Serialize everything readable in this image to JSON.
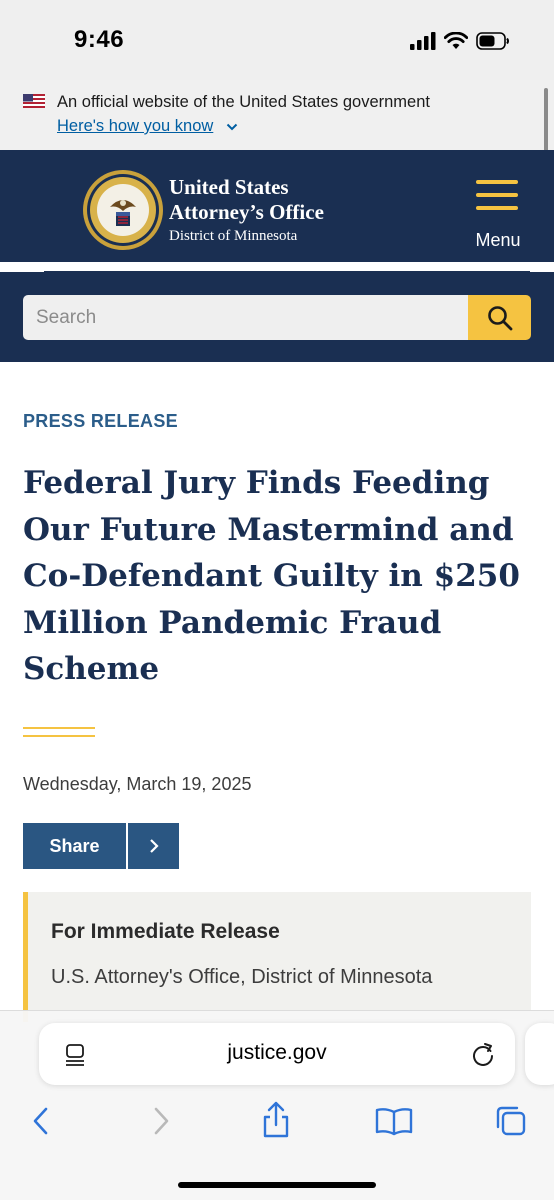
{
  "status_bar": {
    "time": "9:46",
    "icons": [
      "signal-icon",
      "wifi-icon",
      "battery-icon"
    ]
  },
  "gov_banner": {
    "text": "An official website of the United States government",
    "link": "Here's how you know"
  },
  "header": {
    "title_line1": "United States",
    "title_line2": "Attorney’s Office",
    "subtitle": "District of Minnesota",
    "menu_label": "Menu"
  },
  "search": {
    "placeholder": "Search"
  },
  "article": {
    "kicker": "PRESS RELEASE",
    "headline": "Federal Jury Finds Feeding Our Future Mastermind and Co-Defendant Guilty in $250 Million Pandemic Fraud Scheme",
    "date": "Wednesday, March 19, 2025",
    "share_label": "Share",
    "release_title": "For Immediate Release",
    "release_org": "U.S. Attorney's Office, District of Minnesota"
  },
  "browser": {
    "url": "justice.gov",
    "toolbar_icons": [
      "back-icon",
      "forward-icon",
      "share-icon",
      "bookmarks-icon",
      "tabs-icon"
    ]
  },
  "colors": {
    "navy": "#1a2f52",
    "gold": "#f5c341",
    "kicker_blue": "#2b5d8a",
    "link_blue": "#005ea2",
    "share_blue": "#2a5682"
  }
}
